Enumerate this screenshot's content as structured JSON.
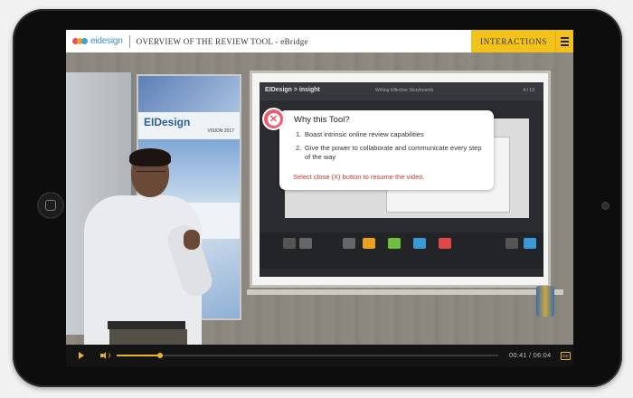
{
  "header": {
    "logo_text": "eidesign",
    "course_title": "OVERVIEW OF THE REVIEW TOOL - eBridge",
    "interactions_label": "INTERACTIONS"
  },
  "video_scene": {
    "poster_brand": "EIDesign",
    "poster_tag": "VISION 2017",
    "projected_brand": "EIDesign > insight",
    "projected_subtitle": "Writing Effective Storyboards",
    "projected_page": "4 / 13"
  },
  "popup": {
    "title": "Why this Tool?",
    "items": [
      {
        "num": "1.",
        "text": "Boast intrinsic online review capabilities"
      },
      {
        "num": "2.",
        "text": "Give the power to collaborate and communicate every step of the way"
      }
    ],
    "resume_text": "Select close (X) button to resume the video."
  },
  "player": {
    "current_time": "00:41",
    "total_time": "06:04",
    "time_display": "00:41 / 06:04",
    "progress": 0.113,
    "cc_label": "CC"
  },
  "colors": {
    "accent": "#f2c21a",
    "player_accent": "#e7b52a",
    "close_red": "#ef5b6a",
    "resume_red": "#c0392b"
  }
}
